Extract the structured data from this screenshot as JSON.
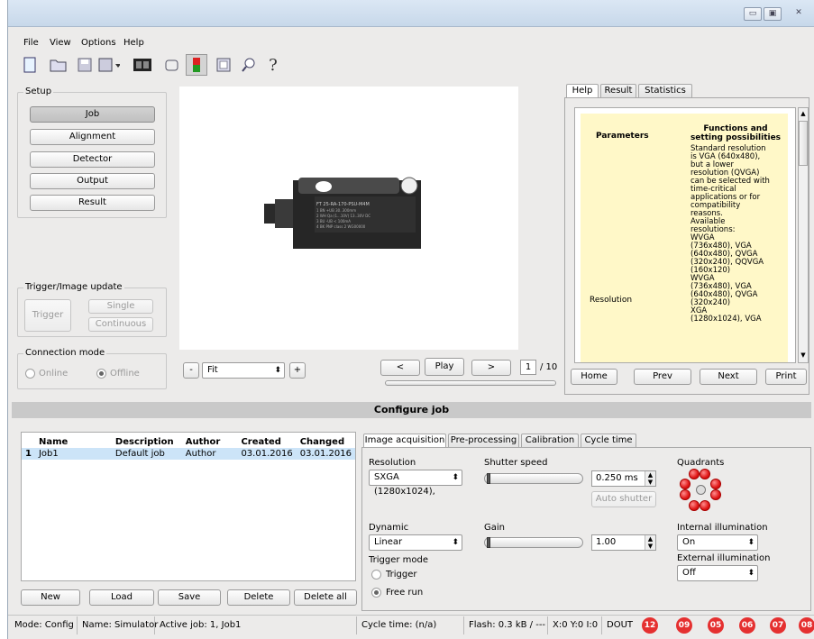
{
  "window": {
    "minimize": "▭",
    "maximize": "▣",
    "close": "✕"
  },
  "menu": [
    "File",
    "View",
    "Options",
    "Help"
  ],
  "toolbar_icons": [
    "new-file-icon",
    "open-folder-icon",
    "save-icon",
    "save-as-icon",
    "film-strip-icon",
    "eraser-icon",
    "sensor-icon",
    "tablet-icon",
    "search-icon",
    "help-question-icon"
  ],
  "setup": {
    "label": "Setup",
    "buttons": [
      "Job",
      "Alignment",
      "Detector",
      "Output",
      "Result"
    ],
    "selected": "Job"
  },
  "trigger": {
    "label": "Trigger/Image update",
    "trigger": "Trigger",
    "single": "Single",
    "continuous": "Continuous"
  },
  "connection": {
    "label": "Connection mode",
    "online": "Online",
    "offline": "Offline",
    "selected": "Offline"
  },
  "image_controls": {
    "minus": "-",
    "zoom": "Fit",
    "plus": "+",
    "prev": "<",
    "play": "Play",
    "next": ">",
    "frame": "1",
    "total": "/ 10"
  },
  "help_tabs": [
    "Help",
    "Result",
    "Statistics"
  ],
  "help_table": {
    "col1": "Parameters",
    "col2": "Functions and setting possibilities",
    "param": "Resolution",
    "text_lines": [
      "Standard resolution",
      "is VGA (640x480),",
      "but a lower",
      "resolution (QVGA)",
      "can be selected with",
      "time-critical",
      "applications or for",
      "compatibility",
      "reasons.",
      "Available",
      "resolutions:",
      "WVGA",
      "(736x480), VGA",
      "(640x480), QVGA",
      "(320x240), QQVGA",
      "(160x120)",
      "WVGA",
      "(736x480), VGA",
      "(640x480), QVGA",
      "(320x240)",
      "XGA",
      "(1280x1024), VGA"
    ]
  },
  "help_buttons": [
    "Home",
    "Prev",
    "Next",
    "Print"
  ],
  "section_title": "Configure job",
  "jobs_table": {
    "headers": [
      "",
      "Name",
      "Description",
      "Author",
      "Created",
      "Changed"
    ],
    "rows": [
      [
        "1",
        "Job1",
        "Default job",
        "Author",
        "03.01.2016",
        "03.01.2016"
      ]
    ]
  },
  "job_buttons": [
    "New",
    "Load",
    "Save",
    "Delete",
    "Delete all"
  ],
  "config_tabs": [
    "Image acquisition",
    "Pre-processing",
    "Calibration",
    "Cycle time"
  ],
  "acq": {
    "resolution_label": "Resolution",
    "resolution_value": "SXGA (1280x1024),",
    "shutter_label": "Shutter speed",
    "shutter_value": "0.250 ms",
    "auto_shutter": "Auto shutter",
    "quadrants_label": "Quadrants",
    "dynamic_label": "Dynamic",
    "dynamic_value": "Linear",
    "gain_label": "Gain",
    "gain_value": "1.00",
    "trigger_mode_label": "Trigger mode",
    "trigger_opt": "Trigger",
    "free_run_opt": "Free run",
    "internal_label": "Internal illumination",
    "internal_value": "On",
    "external_label": "External illumination",
    "external_value": "Off"
  },
  "status": {
    "mode": "Mode: Config",
    "name": "Name: Simulator",
    "active": "Active job: 1, Job1",
    "cycle": "Cycle time: (n/a)",
    "flash": "Flash: 0.3 kB / ---",
    "xyz": "X:0 Y:0 I:0",
    "dout": "DOUT",
    "leds": [
      "12",
      "09",
      "05",
      "06",
      "07",
      "08"
    ]
  },
  "sensor_label": {
    "line1": "FT 25-RA-170-PSU-M4M",
    "line2": "1 BN +UB 30..300mm",
    "line3": "2 WH Qa (1...10V) 13..30V DC",
    "line4": "3 BU -UB < 100mA",
    "line5": "4 BK PNP class 2 WG00000"
  }
}
